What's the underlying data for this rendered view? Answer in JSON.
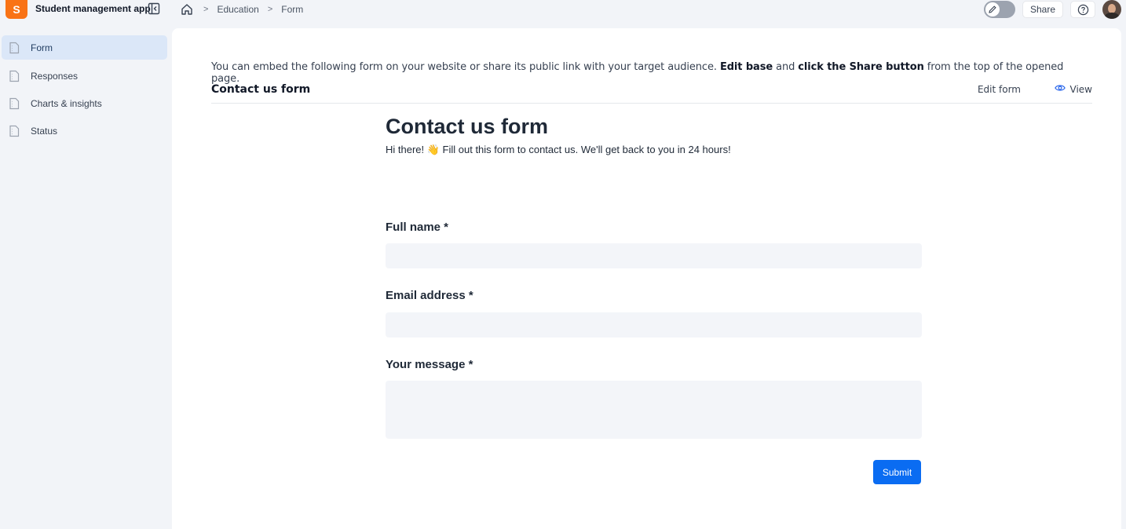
{
  "app": {
    "logo_letter": "S",
    "name": "Student management app",
    "accent": "#f97316"
  },
  "breadcrumb": {
    "home_icon": "home-icon",
    "items": [
      "Education",
      "Form"
    ],
    "separator": ">"
  },
  "topbar": {
    "edit_toggle_icon": "pencil-icon",
    "share_label": "Share",
    "help_icon": "help-circle-icon"
  },
  "sidebar": {
    "items": [
      {
        "label": "Form",
        "icon": "page-icon",
        "active": true
      },
      {
        "label": "Responses",
        "icon": "page-icon",
        "active": false
      },
      {
        "label": "Charts & insights",
        "icon": "page-icon",
        "active": false
      },
      {
        "label": "Status",
        "icon": "page-icon",
        "active": false
      }
    ]
  },
  "main": {
    "embed_note": {
      "part1": "You can embed the following form on your website or share its public link with your target audience. ",
      "bold1": "Edit base",
      "part2": " and ",
      "bold2": "click the Share button",
      "part3": " from the top of the opened page."
    },
    "header_title": "Contact us form",
    "edit_form_label": "Edit form",
    "view_label": "View",
    "view_icon": "eye-icon"
  },
  "form": {
    "title": "Contact us form",
    "subtitle": "Hi there! 👋 Fill out this form to contact us. We'll get back to you in 24 hours!",
    "fields": [
      {
        "label": "Full name *",
        "value": "",
        "placeholder": ""
      },
      {
        "label": "Email address *",
        "value": "",
        "placeholder": ""
      },
      {
        "label": "Your message *",
        "value": "",
        "placeholder": ""
      }
    ],
    "submit_label": "Submit",
    "submit_color": "#0a6cf2"
  }
}
